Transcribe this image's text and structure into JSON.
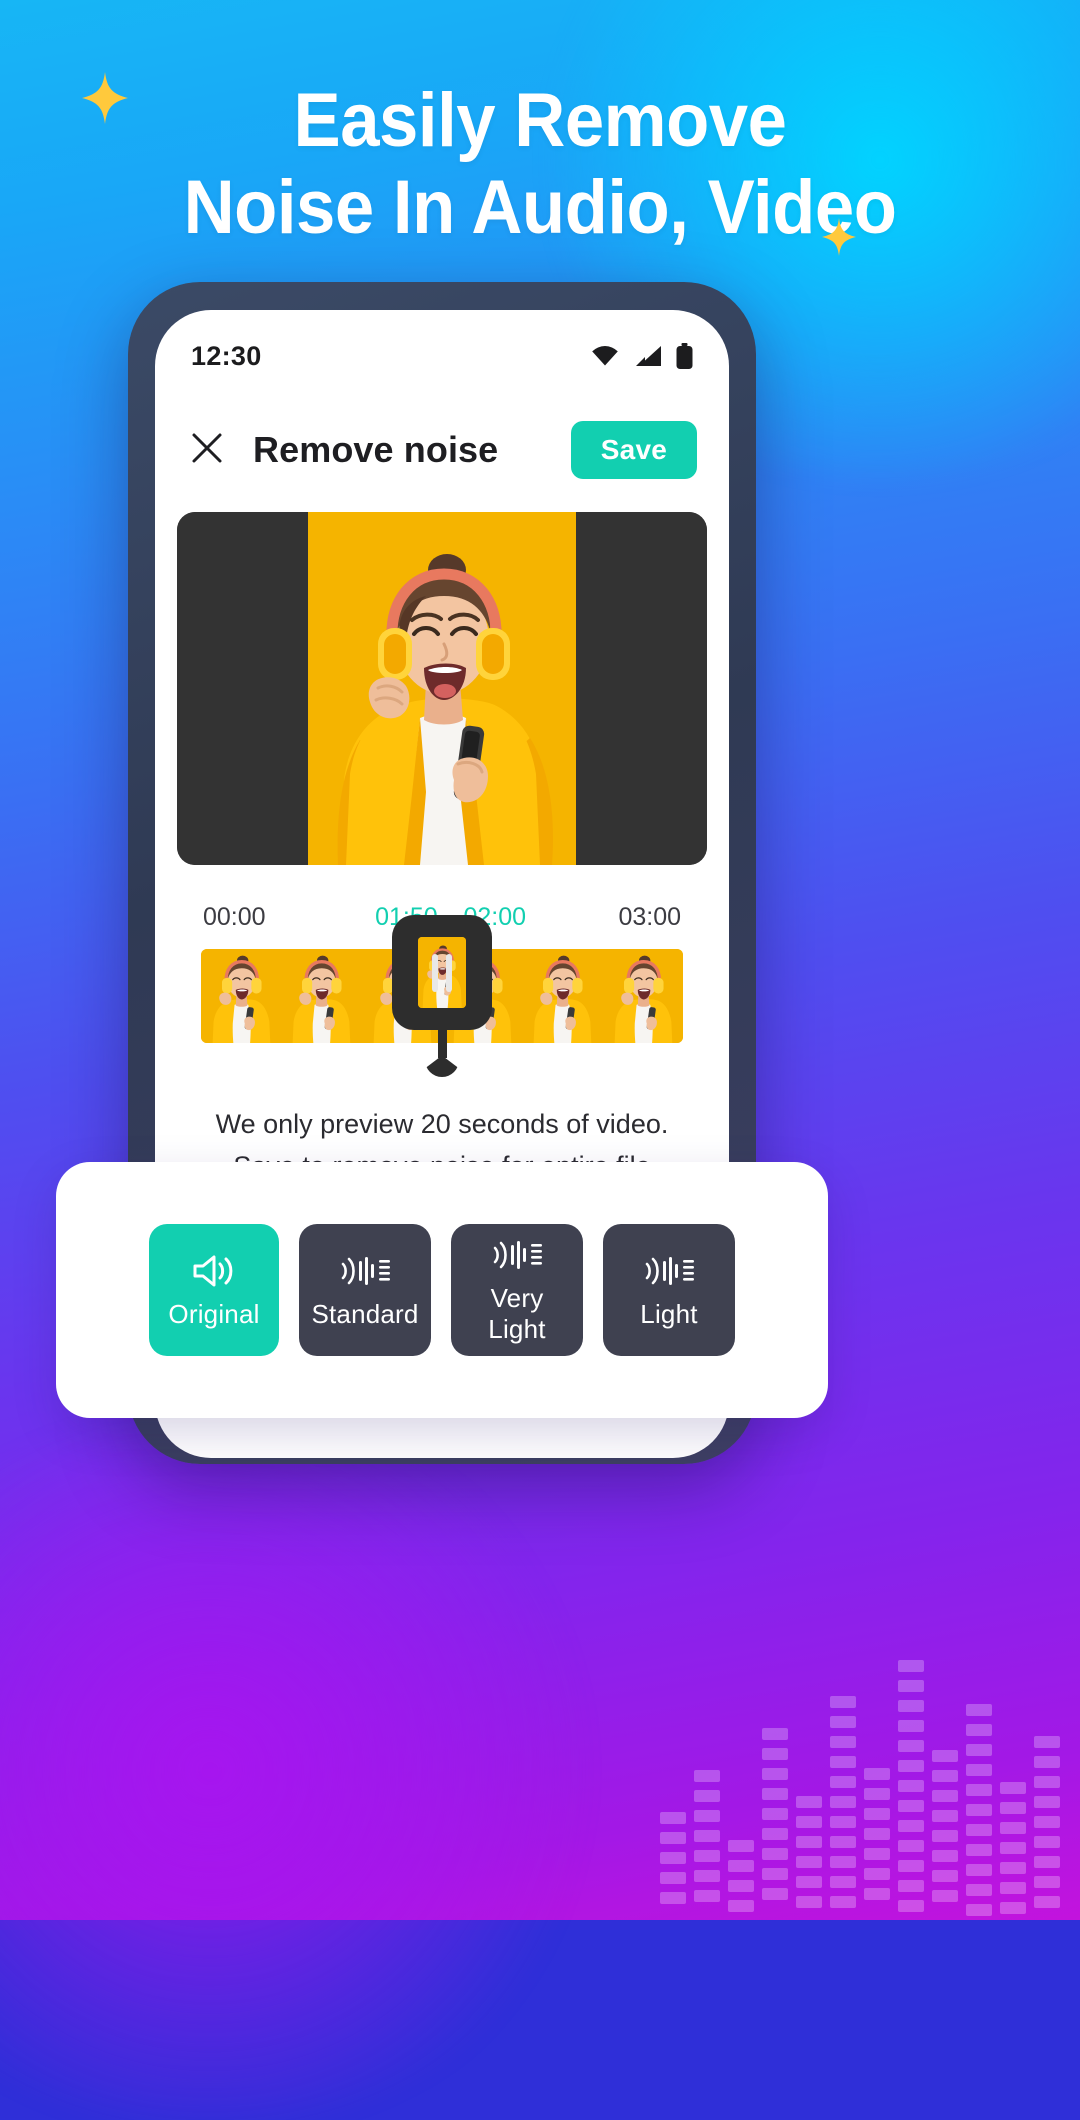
{
  "promo": {
    "headline_line1": "Easily Remove",
    "headline_line2": "Noise In Audio, Video",
    "sparkle_icon": "sparkle-icon",
    "accent_color": "#12cfb0",
    "bg_gradient_from": "#17b6f5",
    "bg_gradient_to": "#c313dd"
  },
  "phone": {
    "statusbar": {
      "time": "12:30",
      "wifi_icon": "wifi-icon",
      "signal_icon": "cellular-signal-icon",
      "battery_icon": "battery-full-icon"
    },
    "header": {
      "close_icon": "close-icon",
      "title": "Remove noise",
      "save_label": "Save"
    },
    "preview": {
      "alt": "woman with headphones singing into a phone"
    },
    "timeline": {
      "labels": [
        "00:00",
        "01:50",
        "02:00",
        "03:00"
      ],
      "current_time": "01:50",
      "selection_time": "02:00",
      "total_time": "03:00",
      "playhead_position_percent": 50
    },
    "caption": {
      "line1": "We only preview 20 seconds of video.",
      "line2": "Save to remove noise for entire file"
    },
    "presets": [
      {
        "label": "Original",
        "icon": "speaker-wave-icon",
        "active": true
      },
      {
        "label": "Standard",
        "icon": "noise-bars-icon",
        "active": false
      },
      {
        "label": "Very Light",
        "icon": "noise-bars-icon",
        "active": false
      },
      {
        "label": "Light",
        "icon": "noise-bars-icon",
        "active": false
      }
    ]
  }
}
